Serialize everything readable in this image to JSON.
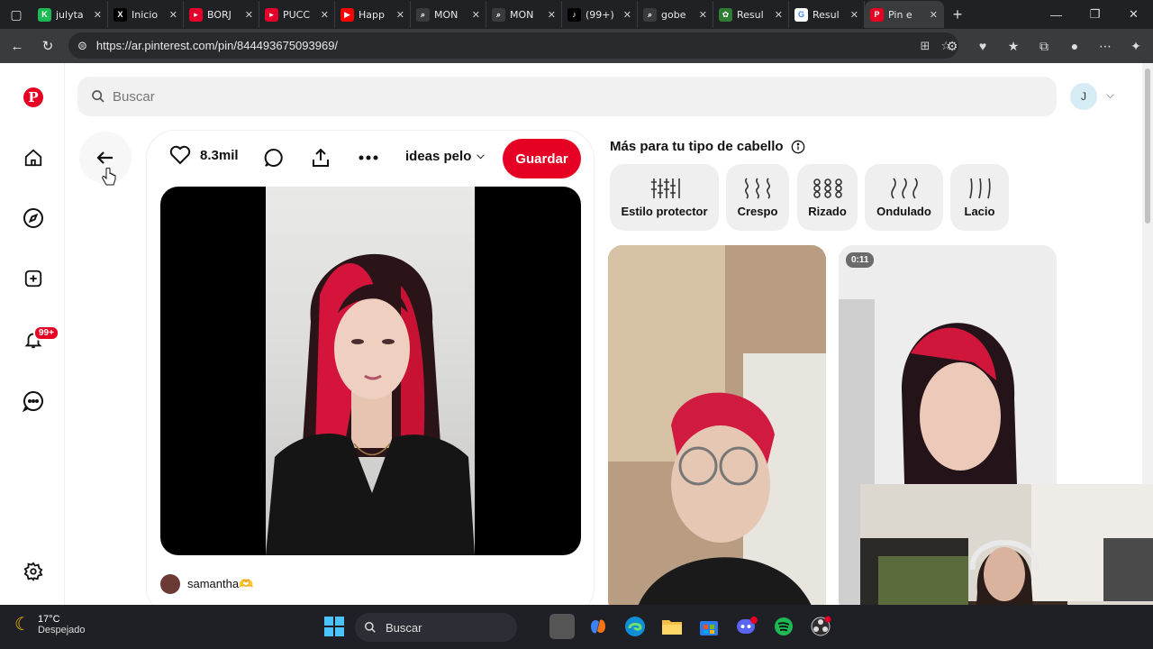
{
  "browser": {
    "tabs": [
      {
        "title": "julyta",
        "fav_color": "#1db954",
        "fav_glyph": "K"
      },
      {
        "title": "Inicio",
        "fav_color": "#000000",
        "fav_glyph": "X"
      },
      {
        "title": "BORJ",
        "fav_color": "#e4002b",
        "fav_glyph": "▸"
      },
      {
        "title": "PUCC",
        "fav_color": "#e4002b",
        "fav_glyph": "▸"
      },
      {
        "title": "Happ",
        "fav_color": "#ff0000",
        "fav_glyph": "▶"
      },
      {
        "title": "MON",
        "fav_color": "#3a3b3d",
        "fav_glyph": "⌕"
      },
      {
        "title": "MON",
        "fav_color": "#3a3b3d",
        "fav_glyph": "⌕"
      },
      {
        "title": "(99+)",
        "fav_color": "#000000",
        "fav_glyph": "♪"
      },
      {
        "title": "gobe",
        "fav_color": "#3a3b3d",
        "fav_glyph": "⌕"
      },
      {
        "title": "Resul",
        "fav_color": "#2e7d32",
        "fav_glyph": "✿"
      },
      {
        "title": "Resul",
        "fav_color": "#ffffff",
        "fav_glyph": "G"
      },
      {
        "title": "Pin e",
        "fav_color": "#e60023",
        "fav_glyph": "P"
      }
    ],
    "url": "https://ar.pinterest.com/pin/844493675093969/"
  },
  "pinterest": {
    "search_placeholder": "Buscar",
    "account_initial": "J",
    "notifications_badge": "99+",
    "likes": "8.3mil",
    "board_name": "ideas pelo",
    "save_label": "Guardar",
    "author": "samantha🫶",
    "more_title": "Más para tu tipo de cabello",
    "hair_chips": [
      "Estilo protector",
      "Crespo",
      "Rizado",
      "Ondulado",
      "Lacio"
    ],
    "video_duration": "0:11"
  },
  "taskbar": {
    "temperature": "17°C",
    "weather": "Despejado",
    "search_label": "Buscar"
  },
  "colors": {
    "pinterest_red": "#e60023"
  }
}
